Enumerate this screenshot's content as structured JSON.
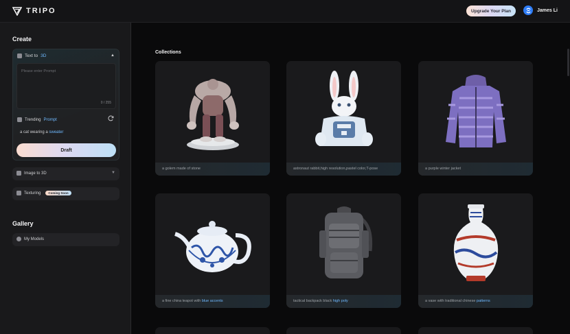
{
  "header": {
    "logo_text": "TRIPO",
    "upgrade_label": "Upgrade Your Plan",
    "user_name": "James Li"
  },
  "sidebar": {
    "create_title": "Create",
    "text_to_3d": {
      "label_prefix": "Text to",
      "label_accent": "3D",
      "prompt_placeholder": "Please enter Prompt",
      "prompt_value": "",
      "char_counter": "0 / 255",
      "trending_prefix": "Trending",
      "trending_accent": "Prompt",
      "suggestion_prefix": "a cat wearing a",
      "suggestion_accent": "sweater",
      "draft_label": "Draft"
    },
    "image_to_3d_label": "Image to 3D",
    "texturing_label": "Texturing",
    "coming_soon_badge": "Coming Soon",
    "gallery_title": "Gallery",
    "my_models_label": "My Models"
  },
  "main": {
    "collections_title": "Collections",
    "items": [
      {
        "caption": "a golem made of stone",
        "icon": "golem-model"
      },
      {
        "caption": "astronaut rabbit,high resolution,pastel color,T-pose",
        "icon": "rabbit-model"
      },
      {
        "caption": "a purple winter jacket",
        "icon": "jacket-model"
      },
      {
        "caption_prefix": "a fine china teapot with",
        "caption_accent": "blue accents",
        "icon": "teapot-model"
      },
      {
        "caption_prefix": "tactical backpack black",
        "caption_accent": "high poly",
        "icon": "backpack-model"
      },
      {
        "caption_prefix": "a vase with traditional chinese",
        "caption_accent": "patterns",
        "icon": "vase-model"
      }
    ]
  },
  "colors": {
    "accent_blue": "#6fb9ff",
    "background": "#0a0a0b",
    "sidebar": "#19191b"
  }
}
